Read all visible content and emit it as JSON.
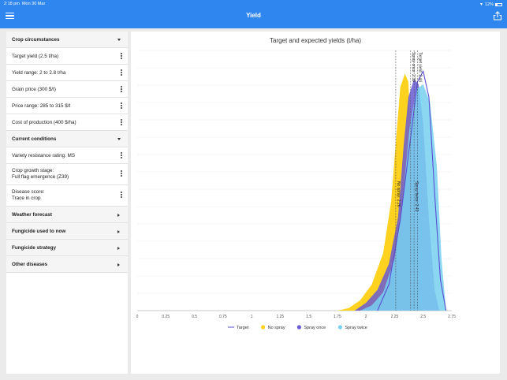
{
  "status": {
    "time": "2:18 pm",
    "date": "Mon 30 Mar",
    "battery": "12%"
  },
  "header": {
    "title": "Yield",
    "menu_icon": "hamburger-icon",
    "share_icon": "share-icon"
  },
  "sidebar": {
    "sections": [
      {
        "title": "Crop circumstances",
        "expanded": true,
        "items": [
          {
            "lines": [
              "Target yield (2.5 t/ha)"
            ]
          },
          {
            "lines": [
              "Yield range: 2 to 2.8 t/ha"
            ]
          },
          {
            "lines": [
              "Grain price (300 $/t)"
            ]
          },
          {
            "lines": [
              "Price range: 285 to 315 $/t"
            ]
          },
          {
            "lines": [
              "Cost of production (400 $/ha)"
            ]
          }
        ]
      },
      {
        "title": "Current conditions",
        "expanded": true,
        "items": [
          {
            "lines": [
              "Variety resistance rating: MS"
            ]
          },
          {
            "lines": [
              "Crop growth stage:",
              "Full flag emergence (Z39)"
            ]
          },
          {
            "lines": [
              "Disease score:",
              "Trace in crop"
            ]
          }
        ]
      },
      {
        "title": "Weather forecast",
        "expanded": false,
        "items": []
      },
      {
        "title": "Fungicide used to now",
        "expanded": false,
        "items": []
      },
      {
        "title": "Fungicide strategy",
        "expanded": false,
        "items": []
      },
      {
        "title": "Other diseases",
        "expanded": false,
        "items": []
      }
    ]
  },
  "chart_data": {
    "type": "area",
    "title": "Target and expected yields (t/ha)",
    "xlim": [
      0,
      2.75
    ],
    "ylim": [
      0,
      1
    ],
    "x_ticks": [
      "0",
      "0.25",
      "0.5",
      "0.75",
      "1",
      "1.25",
      "1.5",
      "1.75",
      "2",
      "2.25",
      "2.5",
      "2.75"
    ],
    "grid": true,
    "legend_position": "bottom",
    "series": [
      {
        "name": "Target",
        "kind": "line",
        "color": "#5a4fd1",
        "points": [
          [
            2.1,
            0
          ],
          [
            2.2,
            0.1
          ],
          [
            2.3,
            0.35
          ],
          [
            2.4,
            0.7
          ],
          [
            2.45,
            0.88
          ],
          [
            2.5,
            0.92
          ],
          [
            2.55,
            0.82
          ],
          [
            2.6,
            0.45
          ],
          [
            2.65,
            0.12
          ],
          [
            2.7,
            0
          ]
        ]
      },
      {
        "name": "No spray",
        "kind": "area",
        "color": "#ffd21f",
        "points": [
          [
            1.75,
            0
          ],
          [
            1.85,
            0.01
          ],
          [
            1.95,
            0.04
          ],
          [
            2.05,
            0.1
          ],
          [
            2.15,
            0.22
          ],
          [
            2.22,
            0.42
          ],
          [
            2.27,
            0.7
          ],
          [
            2.3,
            0.86
          ],
          [
            2.34,
            0.91
          ],
          [
            2.37,
            0.88
          ],
          [
            2.4,
            0.6
          ],
          [
            2.44,
            0.2
          ],
          [
            2.47,
            0.03
          ],
          [
            2.5,
            0
          ]
        ]
      },
      {
        "name": "Spray once",
        "kind": "area",
        "color": "#6a5cd6",
        "points": [
          [
            1.9,
            0
          ],
          [
            2.0,
            0.03
          ],
          [
            2.1,
            0.08
          ],
          [
            2.2,
            0.18
          ],
          [
            2.28,
            0.36
          ],
          [
            2.33,
            0.64
          ],
          [
            2.37,
            0.82
          ],
          [
            2.42,
            0.89
          ],
          [
            2.46,
            0.87
          ],
          [
            2.5,
            0.72
          ],
          [
            2.55,
            0.35
          ],
          [
            2.6,
            0.08
          ],
          [
            2.64,
            0
          ]
        ]
      },
      {
        "name": "Spray twice",
        "kind": "area",
        "color": "#77d0f0",
        "points": [
          [
            1.95,
            0
          ],
          [
            2.05,
            0.02
          ],
          [
            2.15,
            0.07
          ],
          [
            2.25,
            0.2
          ],
          [
            2.32,
            0.42
          ],
          [
            2.38,
            0.7
          ],
          [
            2.44,
            0.85
          ],
          [
            2.5,
            0.87
          ],
          [
            2.56,
            0.8
          ],
          [
            2.62,
            0.55
          ],
          [
            2.66,
            0.2
          ],
          [
            2.7,
            0
          ]
        ]
      }
    ],
    "markers": [
      {
        "x": 2.26,
        "label": "No spray: 2.26",
        "label_pos": "mid"
      },
      {
        "x": 2.39,
        "label": "Spray once: 2.39",
        "label_pos": "top"
      },
      {
        "x": 2.42,
        "label": "Spray twice: 2.43",
        "label_pos": "mid"
      },
      {
        "x": 2.45,
        "label": "Target yield: 2.44",
        "label_pos": "top"
      }
    ]
  }
}
